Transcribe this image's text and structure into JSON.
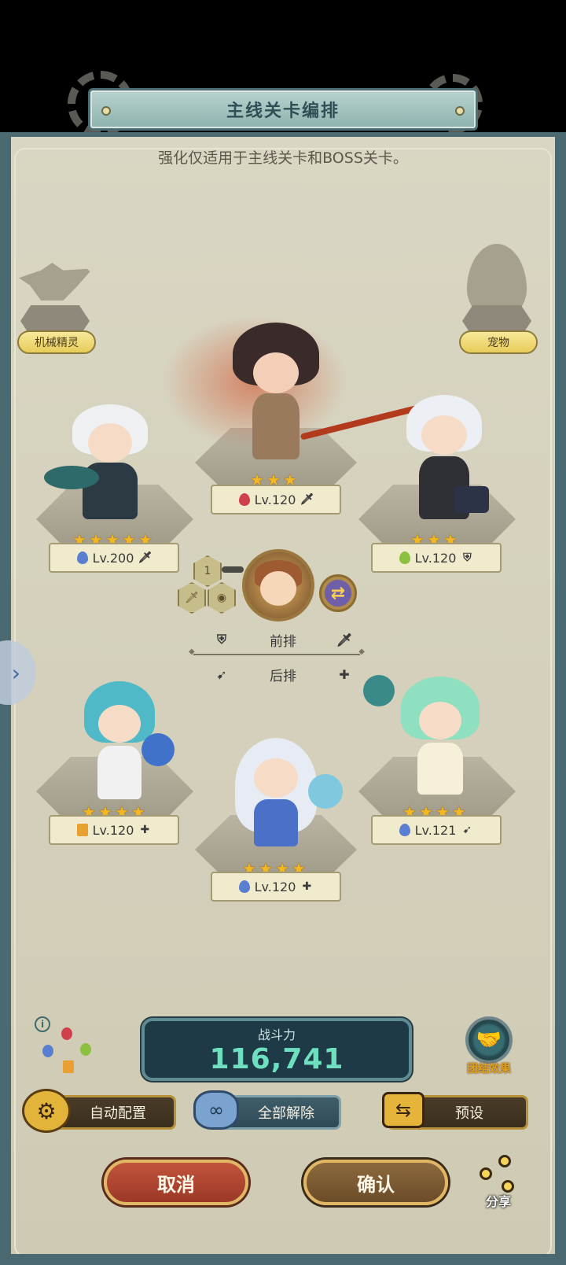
{
  "title": "主线关卡编排",
  "subtitle": "强化仅适用于主线关卡和BOSS关卡。",
  "side_slots": {
    "left_label": "机械精灵",
    "right_label": "宠物"
  },
  "heroes": [
    {
      "slot": "front-left",
      "stars": 5,
      "level": "Lv.200",
      "element": "water",
      "role": "sword"
    },
    {
      "slot": "front-center",
      "stars": 3,
      "level": "Lv.120",
      "element": "fire",
      "role": "sword"
    },
    {
      "slot": "front-right",
      "stars": 3,
      "level": "Lv.120",
      "element": "wind",
      "role": "shield"
    },
    {
      "slot": "back-left",
      "stars": 4,
      "level": "Lv.120",
      "element": "earth",
      "role": "heal"
    },
    {
      "slot": "back-center",
      "stars": 4,
      "level": "Lv.120",
      "element": "water",
      "role": "heal"
    },
    {
      "slot": "back-right",
      "stars": 4,
      "level": "Lv.121",
      "element": "water",
      "role": "bow"
    }
  ],
  "leader": {
    "badge_number": "1"
  },
  "positions": {
    "front_label": "前排",
    "back_label": "后排"
  },
  "power": {
    "label": "战斗力",
    "value": "116,741"
  },
  "team_effect_label": "团结效果",
  "buttons": {
    "auto": "自动配置",
    "clear": "全部解除",
    "preset": "预设",
    "cancel": "取消",
    "confirm": "确认",
    "share": "分享"
  },
  "colors": {
    "water": "#5a7fd0",
    "fire": "#d0404a",
    "wind": "#8cc040",
    "earth": "#e8a030",
    "power_value": "#6ee0c0",
    "star": "#f2b724"
  },
  "icons": {
    "sword": "sword-icon",
    "shield": "shield-icon",
    "heal": "plus-icon",
    "bow": "bow-icon",
    "swap": "swap-icon",
    "info": "info-icon",
    "share": "share-icon"
  }
}
